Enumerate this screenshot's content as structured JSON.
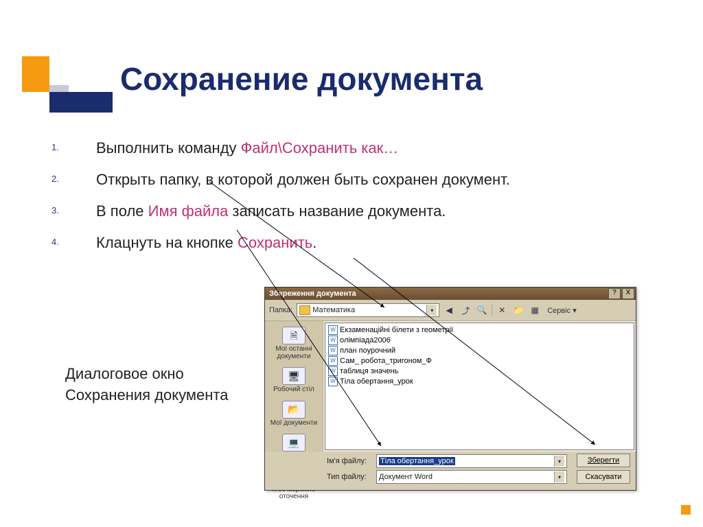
{
  "slide": {
    "title": "Сохранение документа",
    "caption_line1": "Диалоговое окно",
    "caption_line2": "Сохранения документа"
  },
  "steps": {
    "s1a": "Выполнить команду ",
    "s1b": "Файл\\Сохранить как…",
    "s2": "Открыть папку, в которой должен быть сохранен документ.",
    "s3a": "В поле ",
    "s3b": "Имя файла",
    "s3c": " записать название документа.",
    "s4a": "Клацнуть на кнопке ",
    "s4b": "Сохранить",
    "s4c": "."
  },
  "dialog": {
    "title": "Збереження документа",
    "help_btn": "?",
    "close_btn": "X",
    "folder_label": "Папка:",
    "current_folder": "Математика",
    "service_label": "Сервіс",
    "sidebar": {
      "recent": "Мої останні документи",
      "desktop": "Робочий стіл",
      "mydocs": "Мої документи",
      "mycomp": "Мій комп'ютер",
      "network": "Моє мережне оточення"
    },
    "files": {
      "f0": "Екзаменаційні білети з геометрії",
      "f1": "олімпіада2006",
      "f2": "план поурочний",
      "f3": "Сам_ робота_тригоном_Ф",
      "f4": "таблиця значень",
      "f5": "Тіла обертання_урок"
    },
    "filename_label": "Ім'я файлу:",
    "filename_value": "Тіла обертання_урок",
    "filetype_label": "Тип файлу:",
    "filetype_value": "Документ Word",
    "save_btn": "Зберегти",
    "cancel_btn": "Скасувати"
  }
}
